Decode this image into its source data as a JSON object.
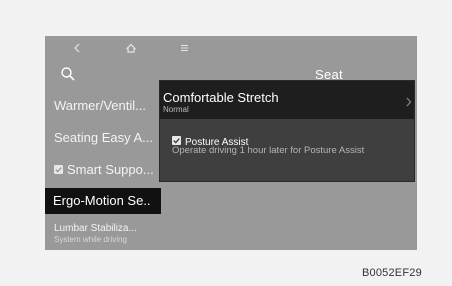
{
  "header": {
    "title": "Seat"
  },
  "menu": {
    "items": [
      {
        "label": "Warmer/Ventil..."
      },
      {
        "label": "Seating Easy A..."
      },
      {
        "label": "Smart Suppo..."
      },
      {
        "label": "Ergo-Motion Se.."
      },
      {
        "label": "Lumbar Stabiliza...",
        "sublabel": "System while driving"
      }
    ]
  },
  "popup": {
    "title": "Comfortable Stretch",
    "subtitle": "Normal",
    "option": {
      "label": "Posture Assist",
      "description": "Operate driving 1 hour later for Posture Assist",
      "checked": true
    }
  },
  "reference_code": "B0052EF29",
  "icons": {
    "back": "chevron-left-icon",
    "home": "home-icon",
    "menu": "menu-icon",
    "search": "search-icon",
    "popup_arrow": "chevron-right-icon"
  },
  "colors": {
    "screen_background": "#999999",
    "selected_item": "#111111",
    "popup_header": "#1e1e1e",
    "popup_body": "#3f3f3f"
  }
}
